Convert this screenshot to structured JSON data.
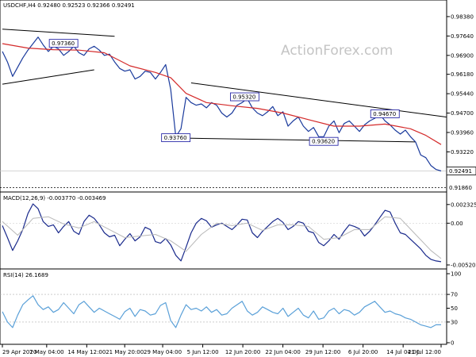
{
  "chart_data": [
    {
      "type": "line",
      "panel": "price",
      "symbol_line": "USDCHF,H4  0.92480 0.92523 0.92366 0.92491",
      "watermark": "ActionForex.com",
      "y_ticks": [
        "0.98380",
        "0.97640",
        "0.96900",
        "0.96180",
        "0.95440",
        "0.94700",
        "0.93960",
        "0.93220"
      ],
      "y_tick_values": [
        0.9838,
        0.9764,
        0.969,
        0.9618,
        0.9544,
        0.947,
        0.9396,
        0.9322
      ],
      "ylim": [
        0.9175,
        0.9865
      ],
      "current_price": {
        "label": "0.92491",
        "value": 0.92491
      },
      "support_level": {
        "label": "0.91860",
        "value": 0.9186
      },
      "annotations": [
        {
          "label": "0.97360",
          "x": 12,
          "y": 0.9736
        },
        {
          "label": "0.95320",
          "x": 47.5,
          "y": 0.9532
        },
        {
          "label": "0.93760",
          "x": 34,
          "y": 0.9376
        },
        {
          "label": "0.93620",
          "x": 63,
          "y": 0.9362
        },
        {
          "label": "0.94670",
          "x": 75,
          "y": 0.9467
        }
      ],
      "trendlines": [
        {
          "x": [
            0,
            22
          ],
          "y": [
            0.979,
            0.9763
          ]
        },
        {
          "x": [
            0,
            18
          ],
          "y": [
            0.958,
            0.9635
          ]
        },
        {
          "x": [
            37,
            87
          ],
          "y": [
            0.9585,
            0.9455
          ]
        },
        {
          "x": [
            34,
            81
          ],
          "y": [
            0.9375,
            0.936
          ]
        }
      ],
      "series": [
        {
          "name": "USDCHF",
          "color": "#1a3a9c",
          "x": [
            0,
            1,
            2,
            3,
            4,
            5,
            6,
            7,
            8,
            9,
            10,
            11,
            12,
            13,
            14,
            15,
            16,
            17,
            18,
            19,
            20,
            21,
            22,
            23,
            24,
            25,
            26,
            27,
            28,
            29,
            30,
            31,
            32,
            33,
            34,
            35,
            36,
            37,
            38,
            39,
            40,
            41,
            42,
            43,
            44,
            45,
            46,
            47,
            48,
            49,
            50,
            51,
            52,
            53,
            54,
            55,
            56,
            57,
            58,
            59,
            60,
            61,
            62,
            63,
            64,
            65,
            66,
            67,
            68,
            69,
            70,
            71,
            72,
            73,
            74,
            75,
            76,
            77,
            78,
            79,
            80,
            81,
            82,
            83,
            84,
            85,
            86
          ],
          "y": [
            0.9705,
            0.9665,
            0.961,
            0.9645,
            0.968,
            0.971,
            0.9735,
            0.976,
            0.973,
            0.9705,
            0.9725,
            0.9715,
            0.969,
            0.9705,
            0.9725,
            0.97,
            0.969,
            0.9715,
            0.9725,
            0.971,
            0.969,
            0.9695,
            0.9665,
            0.964,
            0.963,
            0.9635,
            0.96,
            0.961,
            0.963,
            0.9625,
            0.96,
            0.9625,
            0.9655,
            0.956,
            0.938,
            0.941,
            0.953,
            0.951,
            0.95,
            0.9505,
            0.949,
            0.951,
            0.95,
            0.947,
            0.9455,
            0.947,
            0.95,
            0.951,
            0.9525,
            0.949,
            0.947,
            0.946,
            0.9475,
            0.9495,
            0.946,
            0.9475,
            0.942,
            0.944,
            0.9455,
            0.942,
            0.94,
            0.9415,
            0.938,
            0.938,
            0.942,
            0.944,
            0.9395,
            0.943,
            0.944,
            0.942,
            0.94,
            0.9425,
            0.944,
            0.945,
            0.9465,
            0.944,
            0.9425,
            0.9405,
            0.939,
            0.9405,
            0.938,
            0.936,
            0.931,
            0.93,
            0.927,
            0.9255,
            0.9249
          ]
        },
        {
          "name": "MA",
          "color": "#d42a2a",
          "x": [
            0,
            5,
            10,
            15,
            20,
            25,
            30,
            33,
            36,
            40,
            45,
            50,
            55,
            60,
            65,
            70,
            75,
            80,
            83,
            86
          ],
          "y": [
            0.9735,
            0.9718,
            0.9712,
            0.971,
            0.97,
            0.965,
            0.9625,
            0.9605,
            0.9545,
            0.951,
            0.9498,
            0.9488,
            0.947,
            0.9445,
            0.942,
            0.942,
            0.9428,
            0.941,
            0.9385,
            0.935
          ]
        }
      ]
    },
    {
      "type": "line",
      "panel": "macd",
      "title": "MACD(12,26,9) -0.003770 -0.003469",
      "y_ticks": [
        "0.002325",
        "0.00",
        "-0.005201"
      ],
      "y_tick_values": [
        0.002325,
        0.0,
        -0.005201
      ],
      "ylim": [
        -0.0055,
        0.0027
      ],
      "series": [
        {
          "name": "MACD",
          "color": "#1a2a8c",
          "x": [
            0,
            1,
            2,
            3,
            4,
            5,
            6,
            7,
            8,
            9,
            10,
            11,
            12,
            13,
            14,
            15,
            16,
            17,
            18,
            19,
            20,
            21,
            22,
            23,
            24,
            25,
            26,
            27,
            28,
            29,
            30,
            31,
            32,
            33,
            34,
            35,
            36,
            37,
            38,
            39,
            40,
            41,
            42,
            43,
            44,
            45,
            46,
            47,
            48,
            49,
            50,
            51,
            52,
            53,
            54,
            55,
            56,
            57,
            58,
            59,
            60,
            61,
            62,
            63,
            64,
            65,
            66,
            67,
            68,
            69,
            70,
            71,
            72,
            73,
            74,
            75,
            76,
            77,
            78,
            79,
            80,
            81,
            82,
            83,
            84,
            85,
            86
          ],
          "y": [
            -0.0003,
            -0.0018,
            -0.0034,
            -0.0022,
            -0.0008,
            0.0012,
            0.0024,
            0.0018,
            0.0002,
            -0.0004,
            -0.0002,
            -0.0012,
            -0.0004,
            0.0002,
            -0.001,
            -0.0014,
            0.0002,
            0.001,
            0.0006,
            -0.0002,
            -0.0012,
            -0.0017,
            -0.0015,
            -0.0028,
            -0.002,
            -0.0013,
            -0.0022,
            -0.0017,
            -0.0005,
            -0.0008,
            -0.0023,
            -0.0025,
            -0.0019,
            -0.0027,
            -0.004,
            -0.0047,
            -0.003,
            -0.0012,
            0.0,
            0.0006,
            0.0003,
            -0.0005,
            -0.0002,
            0.0,
            -0.0004,
            -0.0008,
            -0.0002,
            0.0005,
            0.0004,
            -0.0012,
            -0.0018,
            -0.001,
            -0.0004,
            0.0002,
            0.0006,
            0.0001,
            -0.0008,
            -0.0004,
            0.0002,
            0.0,
            -0.001,
            -0.0012,
            -0.0024,
            -0.0028,
            -0.0022,
            -0.0014,
            -0.002,
            -0.001,
            -0.0002,
            -0.0004,
            -0.0007,
            -0.0016,
            -0.001,
            -0.0002,
            0.0007,
            0.0016,
            0.0014,
            0.0,
            -0.0012,
            -0.0014,
            -0.002,
            -0.0026,
            -0.0032,
            -0.004,
            -0.0045,
            -0.0047,
            -0.0048
          ]
        },
        {
          "name": "Signal",
          "color": "#b8b8b8",
          "x": [
            0,
            3,
            6,
            9,
            12,
            15,
            18,
            21,
            24,
            27,
            30,
            33,
            36,
            39,
            42,
            45,
            48,
            51,
            54,
            57,
            60,
            63,
            66,
            69,
            72,
            75,
            78,
            81,
            84,
            86
          ],
          "y": [
            0.0002,
            -0.0015,
            0.0006,
            0.0008,
            -0.0001,
            -0.0006,
            0.0002,
            -0.0008,
            -0.0018,
            -0.0016,
            -0.0014,
            -0.0022,
            -0.0035,
            -0.0014,
            0.0,
            -0.0003,
            0.0,
            -0.0009,
            -0.0002,
            -0.0002,
            -0.0004,
            -0.002,
            -0.0018,
            -0.0008,
            -0.0008,
            0.0008,
            0.0006,
            -0.0014,
            -0.0034,
            -0.0044
          ]
        }
      ]
    },
    {
      "type": "line",
      "panel": "rsi",
      "title": "RSI(14) 26.1689",
      "y_ticks": [
        "100",
        "70",
        "50",
        "30",
        "0"
      ],
      "y_tick_values": [
        100,
        70,
        50,
        30,
        0
      ],
      "ylim": [
        0,
        100
      ],
      "series": [
        {
          "name": "RSI",
          "color": "#5aa0d8",
          "x": [
            0,
            1,
            2,
            3,
            4,
            5,
            6,
            7,
            8,
            9,
            10,
            11,
            12,
            13,
            14,
            15,
            16,
            17,
            18,
            19,
            20,
            21,
            22,
            23,
            24,
            25,
            26,
            27,
            28,
            29,
            30,
            31,
            32,
            33,
            34,
            35,
            36,
            37,
            38,
            39,
            40,
            41,
            42,
            43,
            44,
            45,
            46,
            47,
            48,
            49,
            50,
            51,
            52,
            53,
            54,
            55,
            56,
            57,
            58,
            59,
            60,
            61,
            62,
            63,
            64,
            65,
            66,
            67,
            68,
            69,
            70,
            71,
            72,
            73,
            74,
            75,
            76,
            77,
            78,
            79,
            80,
            81,
            82,
            83,
            84,
            85,
            86
          ],
          "y": [
            45,
            30,
            22,
            40,
            55,
            62,
            68,
            55,
            48,
            52,
            44,
            48,
            58,
            50,
            42,
            55,
            60,
            52,
            44,
            50,
            46,
            42,
            38,
            34,
            45,
            50,
            38,
            48,
            46,
            40,
            42,
            54,
            58,
            32,
            22,
            40,
            55,
            48,
            50,
            46,
            52,
            44,
            48,
            40,
            42,
            50,
            55,
            60,
            46,
            40,
            44,
            52,
            48,
            44,
            42,
            50,
            38,
            44,
            50,
            40,
            36,
            46,
            34,
            36,
            46,
            50,
            42,
            48,
            46,
            40,
            44,
            52,
            56,
            60,
            52,
            44,
            46,
            42,
            40,
            36,
            34,
            30,
            26,
            24,
            22,
            26,
            26
          ]
        }
      ]
    },
    {
      "type": "table",
      "panel": "x-axis",
      "x_ticks": [
        {
          "label": "29 Apr 2020",
          "x": 0
        },
        {
          "label": "7 May 04:00",
          "x": 10.5
        },
        {
          "label": "14 May 12:00",
          "x": 20
        },
        {
          "label": "21 May 20:00",
          "x": 29
        },
        {
          "label": "29 May 04:00",
          "x": 38
        },
        {
          "label": "5 Jun 12:00",
          "x": 47.5
        },
        {
          "label": "12 Jun 20:00",
          "x": 57
        },
        {
          "label": "22 Jun 04:00",
          "x": 66.5
        },
        {
          "label": "29 Jun 12:00",
          "x": 76
        },
        {
          "label": "6 Jul 20:00",
          "x": 85.5
        },
        {
          "label": "14 Jul 04:00",
          "x": 95
        },
        {
          "label": "21 Jul 12:00",
          "x": 104
        }
      ]
    }
  ]
}
